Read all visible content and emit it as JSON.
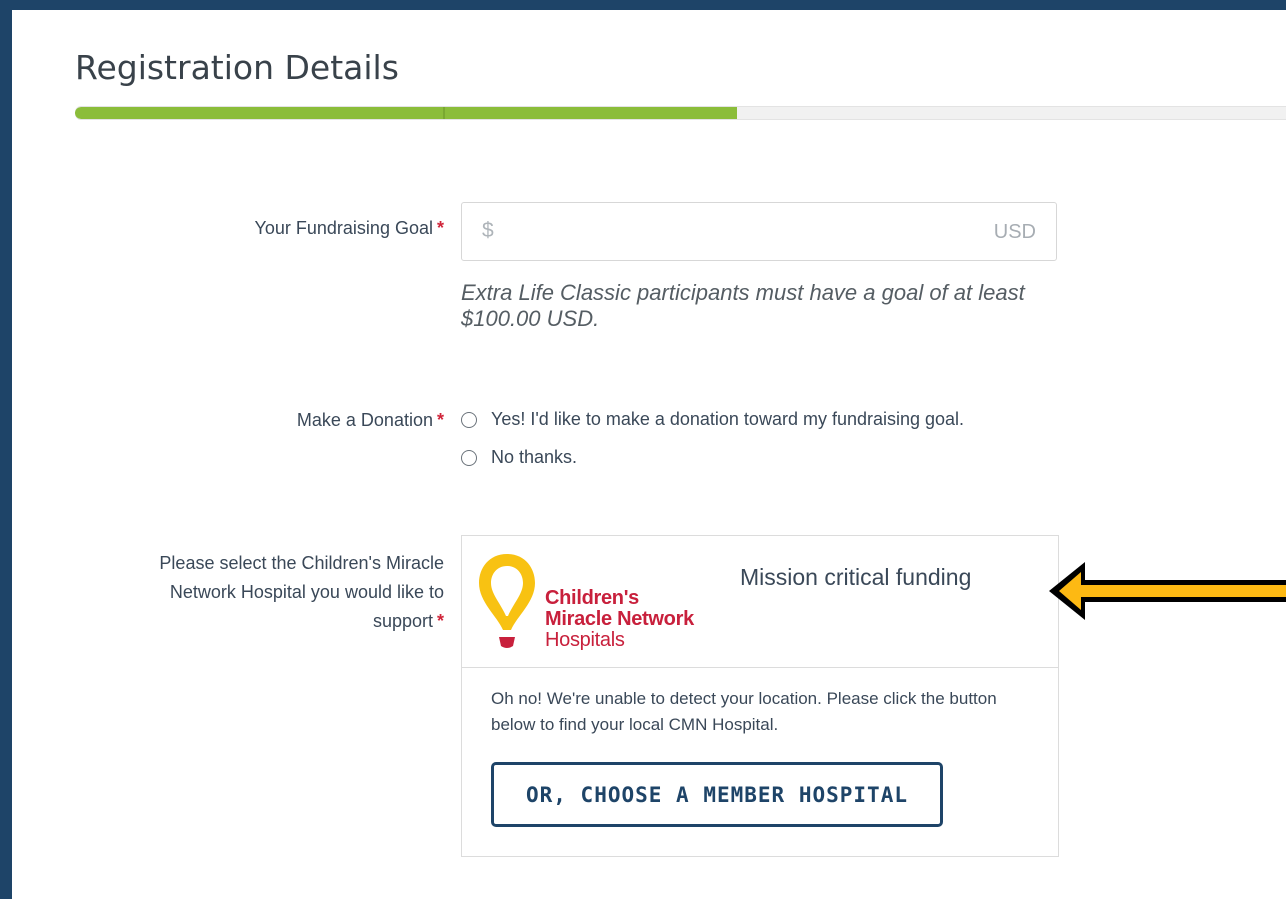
{
  "page": {
    "title": "Registration Details",
    "progress_percent": 54.7
  },
  "fundraising_goal": {
    "label": "Your Fundraising Goal",
    "required_mark": "*",
    "currency_symbol": "$",
    "currency_code": "USD",
    "value": "",
    "help_text": "Extra Life Classic participants must have a goal of at least $100.00 USD."
  },
  "donation": {
    "label": "Make a Donation",
    "required_mark": "*",
    "options": [
      {
        "label": "Yes! I'd like to make a donation toward my fundraising goal.",
        "selected": false
      },
      {
        "label": "No thanks.",
        "selected": false
      }
    ]
  },
  "hospital": {
    "label_line1": "Please select the Children's Miracle",
    "label_line2": "Network Hospital you would like to",
    "label_line3": "support",
    "required_mark": "*",
    "logo": {
      "line1": "Children's",
      "line2": "Miracle Network",
      "line3": "Hospitals"
    },
    "card_title": "Mission critical funding",
    "message": "Oh no! We're unable to detect your location. Please click the button below to find your local CMN Hospital.",
    "button_label": "OR, CHOOSE A MEMBER HOSPITAL"
  },
  "colors": {
    "frame": "#1e4468",
    "progress": "#8bbd3a",
    "required": "#d0253a",
    "brand_red": "#c8203c",
    "brand_yellow": "#f8c212",
    "arrow": "#fdb913"
  }
}
